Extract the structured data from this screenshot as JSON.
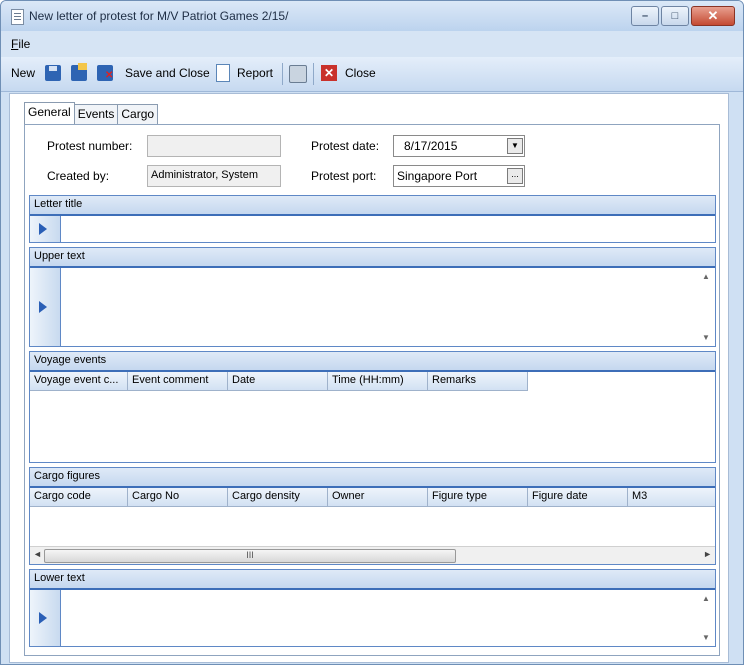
{
  "window": {
    "title": "New letter of protest for M/V Patriot Games 2/15/",
    "controls": [
      "–",
      "□",
      "✕"
    ]
  },
  "menu": {
    "file": "File"
  },
  "toolbar": {
    "new": "New",
    "save_and_close": "Save and Close",
    "report": "Report",
    "close": "Close"
  },
  "tabs": [
    "General",
    "Events",
    "Cargo"
  ],
  "general": {
    "protest_number_label": "Protest number:",
    "protest_number_value": "",
    "created_by_label": "Created by:",
    "created_by_value": "Administrator, System",
    "protest_date_label": "Protest date:",
    "protest_date_value": "8/17/2015",
    "protest_port_label": "Protest port:",
    "protest_port_value": "Singapore Port",
    "browse_label": "..."
  },
  "sections": {
    "letter_title": "Letter title",
    "upper_text": "Upper text",
    "voyage_events": "Voyage events",
    "cargo_figures": "Cargo figures",
    "lower_text": "Lower text"
  },
  "voyage_columns": [
    "Voyage event c...",
    "Event comment",
    "Date",
    "Time (HH:mm)",
    "Remarks"
  ],
  "cargo_columns": [
    "Cargo code",
    "Cargo No",
    "Cargo density",
    "Owner",
    "Figure type",
    "Figure date",
    "M3"
  ],
  "scroll_grip": "III"
}
